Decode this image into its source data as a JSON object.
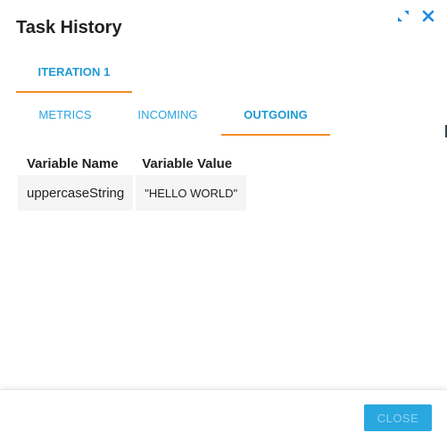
{
  "dialog": {
    "title": "Task History",
    "icons": {
      "expand": "expand-icon",
      "close": "close-icon"
    },
    "iteration_tabs": [
      {
        "label": "ITERATION 1",
        "active": true
      }
    ],
    "section_tabs": [
      {
        "label": "METRICS",
        "active": false
      },
      {
        "label": "INCOMING",
        "active": false
      },
      {
        "label": "OUTGOING",
        "active": true
      }
    ],
    "table": {
      "headers": [
        "Variable Name",
        "Variable Value"
      ],
      "rows": [
        [
          "uppercaseString",
          "\"HELLO WORLD\""
        ]
      ]
    },
    "footer": {
      "close_label": "CLOSE"
    },
    "colors": {
      "accent": "#29a3e0",
      "tab_underline": "#f28c28",
      "close_button": "#29a8e0",
      "icon_blue": "#1e88e5"
    }
  }
}
